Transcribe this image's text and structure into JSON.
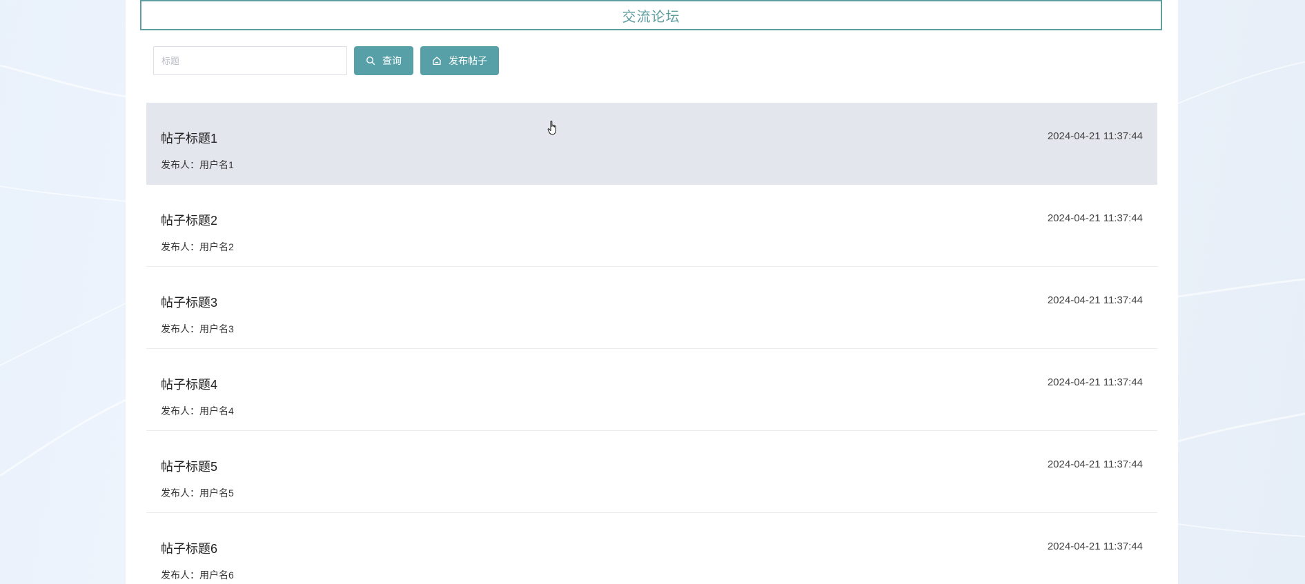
{
  "header": {
    "title": "交流论坛"
  },
  "search": {
    "placeholder": "标题",
    "value": ""
  },
  "toolbar": {
    "query_label": "查询",
    "query_icon": "search-icon",
    "publish_label": "发布帖子",
    "publish_icon": "home-icon"
  },
  "colors": {
    "accent": "#57a0a7",
    "title_border": "#5f9ea0",
    "hover_row": "#e4e6ee"
  },
  "posts": [
    {
      "title": "帖子标题1",
      "author_prefix": "发布人：",
      "author": "用户名1",
      "time": "2024-04-21 11:37:44"
    },
    {
      "title": "帖子标题2",
      "author_prefix": "发布人：",
      "author": "用户名2",
      "time": "2024-04-21 11:37:44"
    },
    {
      "title": "帖子标题3",
      "author_prefix": "发布人：",
      "author": "用户名3",
      "time": "2024-04-21 11:37:44"
    },
    {
      "title": "帖子标题4",
      "author_prefix": "发布人：",
      "author": "用户名4",
      "time": "2024-04-21 11:37:44"
    },
    {
      "title": "帖子标题5",
      "author_prefix": "发布人：",
      "author": "用户名5",
      "time": "2024-04-21 11:37:44"
    },
    {
      "title": "帖子标题6",
      "author_prefix": "发布人：",
      "author": "用户名6",
      "time": "2024-04-21 11:37:44"
    }
  ]
}
